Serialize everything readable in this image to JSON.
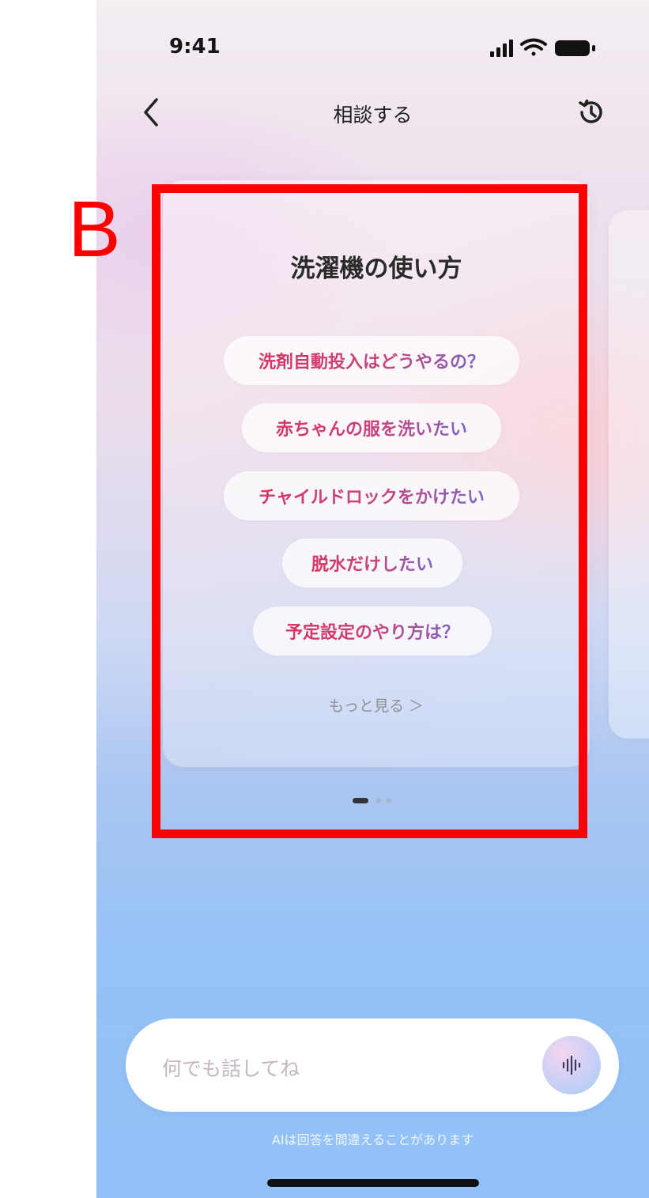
{
  "status_bar": {
    "time": "9:41"
  },
  "nav": {
    "title": "相談する"
  },
  "card": {
    "title": "洗濯機の使い方",
    "suggestions": [
      "洗剤自動投入はどうやるの？",
      "赤ちゃんの服を洗いたい",
      "チャイルドロックをかけたい",
      "脱水だけしたい",
      "予定設定のやり方は？"
    ],
    "more": "もっと見る ＞"
  },
  "pager": {
    "total": 3,
    "current": 1
  },
  "annotation": {
    "label": "B",
    "color": "#ff0000"
  },
  "input": {
    "placeholder": "何でも話してね"
  },
  "disclaimer": "AIは回答を間違えることがあります",
  "colors": {
    "accent": "#d9335f",
    "accent_end": "#7a65c7"
  }
}
